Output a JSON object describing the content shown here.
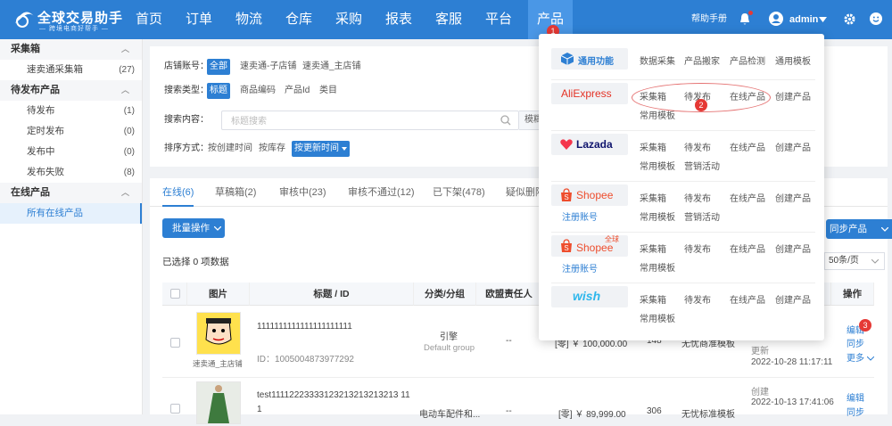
{
  "app": {
    "logo_title": "全球交易助手",
    "logo_sub": "— 跨境电商好帮手 —",
    "nav": [
      "首页",
      "订单",
      "物流",
      "仓库",
      "采购",
      "报表",
      "客服",
      "平台",
      "产品"
    ],
    "nav_active_badge": "1",
    "help": "帮助手册",
    "user": "admin"
  },
  "sidebar": {
    "groups": [
      {
        "label": "采集箱",
        "items": [
          {
            "label": "速卖通采集箱",
            "count": "(27)"
          }
        ]
      },
      {
        "label": "待发布产品",
        "items": [
          {
            "label": "待发布",
            "count": "(1)"
          },
          {
            "label": "定时发布",
            "count": "(0)"
          },
          {
            "label": "发布中",
            "count": "(0)"
          },
          {
            "label": "发布失败",
            "count": "(8)"
          }
        ]
      },
      {
        "label": "在线产品",
        "items": [
          {
            "label": "所有在线产品",
            "count": ""
          }
        ]
      }
    ]
  },
  "filters": {
    "store_label": "店铺账号：",
    "store_opts": [
      "全部",
      "速卖通-子店铺",
      "速卖通_主店铺"
    ],
    "search_type_label": "搜索类型：",
    "search_type_opts": [
      "标题",
      "商品编码",
      "产品Id",
      "类目"
    ],
    "search_label": "搜索内容：",
    "search_placeholder": "标题搜索",
    "search_mode": "模糊查",
    "sort_label": "排序方式：",
    "sort_opts": [
      "按创建时间",
      "按库存",
      "按更新时间"
    ]
  },
  "tabs": [
    "在线(6)",
    "草稿箱(2)",
    "审核中(23)",
    "审核不通过(12)",
    "已下架(478)",
    "疑似删除"
  ],
  "toolbar": {
    "bulk": "批量操作",
    "selected_info": "已选择 0 项数据",
    "sync": "同步产品",
    "page_size": "50条/页"
  },
  "table": {
    "headers": [
      "图片",
      "标题 / ID",
      "分类/分组",
      "欧盟责任人",
      "",
      "",
      "",
      "",
      "操作"
    ],
    "rows": [
      {
        "store": "速卖通_主店铺",
        "title": "1111111111111111111111",
        "id": "ID：1005004873977292",
        "cat1": "引擎",
        "cat2": "Default group",
        "eu": "--",
        "price": "[零] ￥ 100,000.00",
        "stock": "148",
        "tpl": "无忧商准模板",
        "time_label": "更新",
        "time": "2022-10-28 11:17:11",
        "ops": [
          "编辑",
          "同步",
          "更多"
        ]
      },
      {
        "title": "test11112223333123213213213213 11",
        "title2": "1",
        "cat1": "电动车配件和...",
        "eu": "--",
        "price": "[零] ￥ 89,999.00",
        "stock": "306",
        "tpl": "无忧标准模板",
        "time_label": "创建",
        "time": "2022-10-13 17:41:06",
        "ops": [
          "编辑",
          "同步"
        ]
      }
    ]
  },
  "menu": {
    "badge2": "2",
    "badge3": "3",
    "platforms": [
      {
        "name": "通用功能",
        "links": [
          "数据采集",
          "产品搬家",
          "产品检测",
          "通用模板"
        ]
      },
      {
        "name": "AliExpress",
        "links": [
          "采集箱",
          "待发布",
          "在线产品",
          "创建产品",
          "常用模板"
        ]
      },
      {
        "name": "Lazada",
        "links": [
          "采集箱",
          "待发布",
          "在线产品",
          "创建产品",
          "常用模板",
          "营销活动"
        ]
      },
      {
        "name": "Shopee",
        "links": [
          "采集箱",
          "待发布",
          "在线产品",
          "创建产品",
          "常用模板",
          "营销活动"
        ],
        "register": "注册账号"
      },
      {
        "name": "Shopee",
        "tag": "全球",
        "links": [
          "采集箱",
          "待发布",
          "在线产品",
          "创建产品",
          "常用模板"
        ],
        "register": "注册账号"
      },
      {
        "name": "wish",
        "links": [
          "采集箱",
          "待发布",
          "在线产品",
          "创建产品",
          "常用模板"
        ]
      }
    ]
  },
  "colors": {
    "primary": "#2d7fd3",
    "badge": "#e53935",
    "aliexpress": "#e43225",
    "lazada": "#0f146d",
    "shopee": "#ee4d2d",
    "wish": "#2fb7ec"
  }
}
